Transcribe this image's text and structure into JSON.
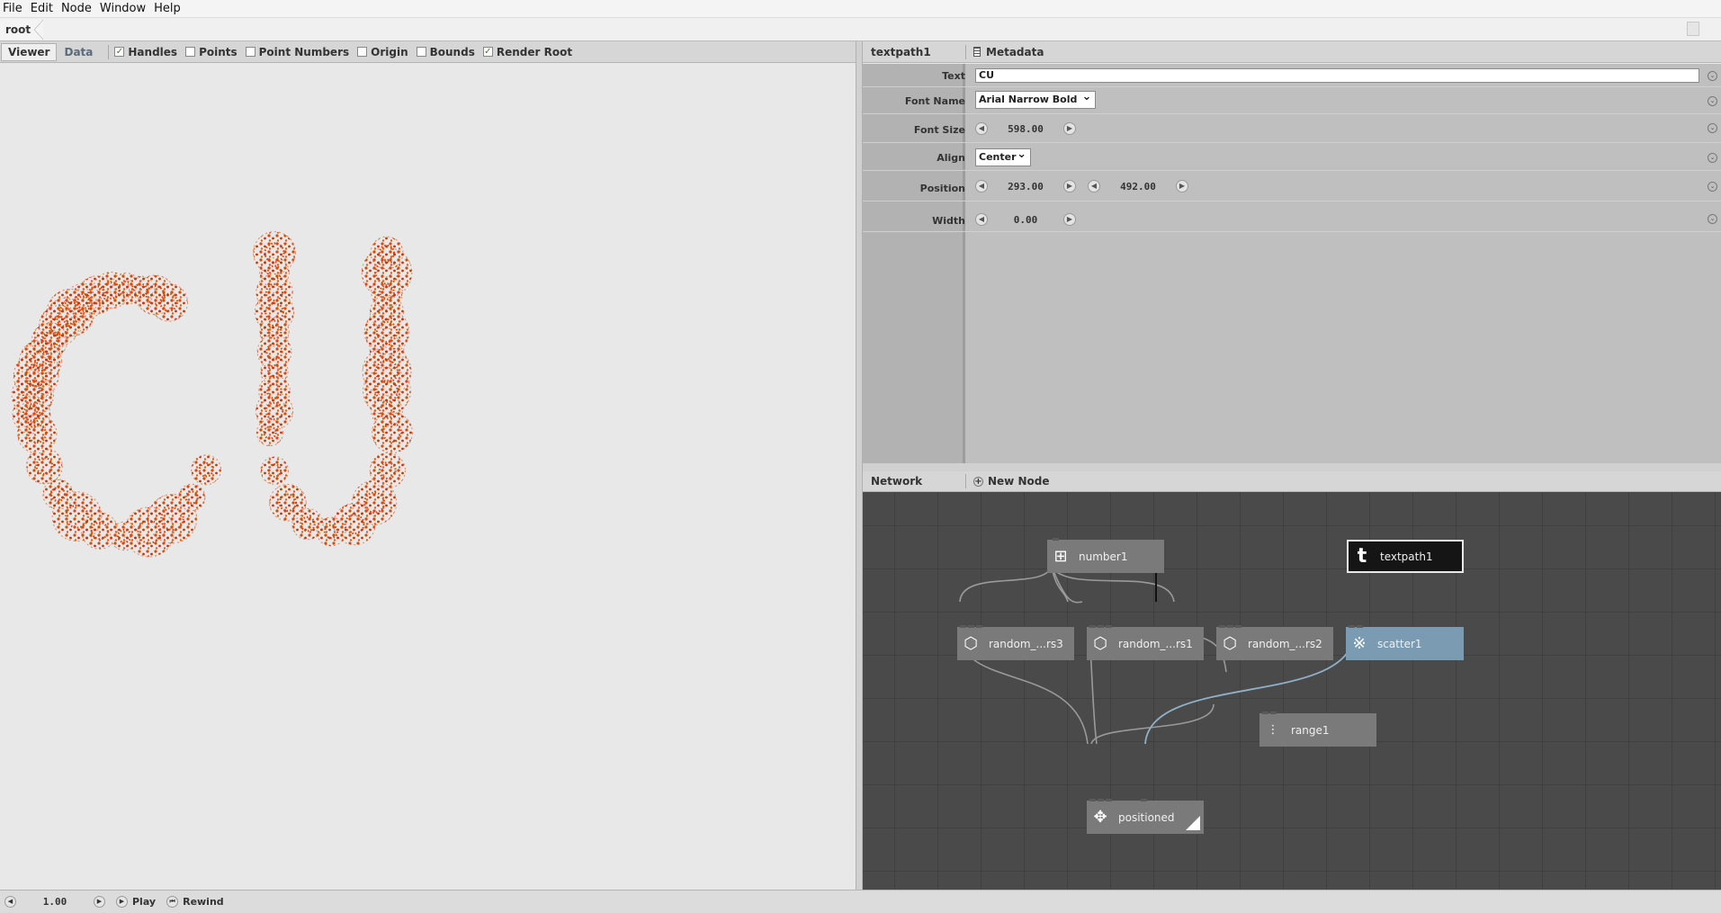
{
  "menu": [
    "File",
    "Edit",
    "Node",
    "Window",
    "Help"
  ],
  "address": {
    "crumb": "root"
  },
  "viewer_toolbar": {
    "tabs": [
      "Viewer",
      "Data"
    ],
    "checks": [
      {
        "label": "Handles",
        "checked": true
      },
      {
        "label": "Points",
        "checked": false
      },
      {
        "label": "Point Numbers",
        "checked": false
      },
      {
        "label": "Origin",
        "checked": false
      },
      {
        "label": "Bounds",
        "checked": false
      },
      {
        "label": "Render Root",
        "checked": true
      }
    ]
  },
  "inspector": {
    "node_name": "textpath1",
    "metadata_label": "Metadata",
    "params": {
      "text": {
        "label": "Text",
        "value": "CU"
      },
      "font_name": {
        "label": "Font Name",
        "value": "Arial Narrow Bold"
      },
      "font_size": {
        "label": "Font Size",
        "value": "598.00"
      },
      "align": {
        "label": "Align",
        "value": "Center"
      },
      "position": {
        "label": "Position",
        "x": "293.00",
        "y": "492.00"
      },
      "width": {
        "label": "Width",
        "value": "0.00"
      }
    }
  },
  "network": {
    "title": "Network",
    "new_node_label": "New Node",
    "nodes": {
      "number1": {
        "label": "number1",
        "icon": "number-icon"
      },
      "textpath1": {
        "label": "textpath1",
        "icon": "text-icon"
      },
      "random_rs3": {
        "label": "random_...rs3",
        "icon": "dice-icon"
      },
      "random_rs1": {
        "label": "random_...rs1",
        "icon": "dice-icon"
      },
      "random_rs2": {
        "label": "random_...rs2",
        "icon": "dice-icon"
      },
      "scatter1": {
        "label": "scatter1",
        "icon": "scatter-icon"
      },
      "range1": {
        "label": "range1",
        "icon": "range-icon"
      },
      "positioned": {
        "label": "positioned",
        "icon": "move-icon"
      }
    },
    "colors": {
      "selected": "#151515",
      "rendered": "#7b9bb2",
      "node": "#7a7a7a",
      "wire": "#9a9a9a",
      "render_wire": "#8fb0c6"
    }
  },
  "viewer": {
    "render_color": "#d94a0a",
    "render_text": "CU"
  },
  "playback": {
    "frame": "1.00",
    "play_label": "Play",
    "rewind_label": "Rewind"
  }
}
